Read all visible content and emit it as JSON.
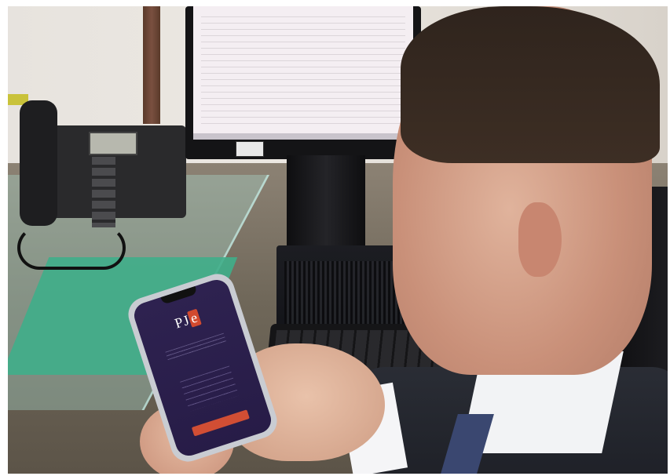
{
  "phone_app": {
    "logo_text": "PJ",
    "logo_accent_text": "e",
    "colors": {
      "app_background": "#2b1f4d",
      "logo_accent": "#d24a2f",
      "button": "#d14e34"
    }
  },
  "scene_icons": [
    "desk-phone-icon",
    "monitor-icon",
    "pc-tower-icon",
    "keyboard-icon",
    "smartphone-icon"
  ]
}
